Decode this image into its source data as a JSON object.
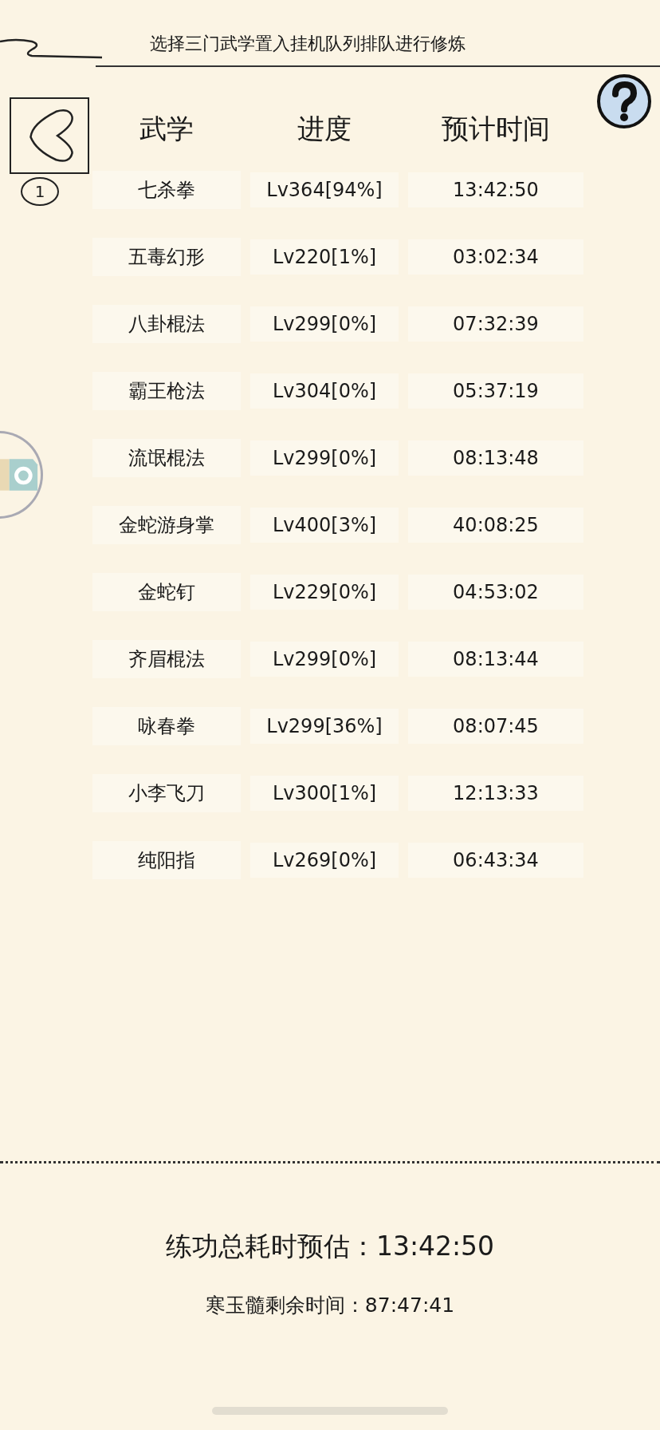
{
  "title": "选择三门武学置入挂机队列排队进行修炼",
  "columns": [
    "武学",
    "进度",
    "预计时间"
  ],
  "rows": [
    {
      "name": "七杀拳",
      "progress": "Lv364[94%]",
      "time": "13:42:50",
      "badge": "1"
    },
    {
      "name": "五毒幻形",
      "progress": "Lv220[1%]",
      "time": "03:02:34"
    },
    {
      "name": "八卦棍法",
      "progress": "Lv299[0%]",
      "time": "07:32:39"
    },
    {
      "name": "霸王枪法",
      "progress": "Lv304[0%]",
      "time": "05:37:19"
    },
    {
      "name": "流氓棍法",
      "progress": "Lv299[0%]",
      "time": "08:13:48"
    },
    {
      "name": "金蛇游身掌",
      "progress": "Lv400[3%]",
      "time": "40:08:25"
    },
    {
      "name": "金蛇钉",
      "progress": "Lv229[0%]",
      "time": "04:53:02"
    },
    {
      "name": "齐眉棍法",
      "progress": "Lv299[0%]",
      "time": "08:13:44"
    },
    {
      "name": "咏春拳",
      "progress": "Lv299[36%]",
      "time": "08:07:45"
    },
    {
      "name": "小李飞刀",
      "progress": "Lv300[1%]",
      "time": "12:13:33"
    },
    {
      "name": "纯阳指",
      "progress": "Lv269[0%]",
      "time": "06:43:34"
    }
  ],
  "total": {
    "label": "练功总耗时预估：",
    "value": "13:42:50"
  },
  "remaining": {
    "label": "寒玉髓剩余时间：",
    "value": "87:47:41"
  }
}
